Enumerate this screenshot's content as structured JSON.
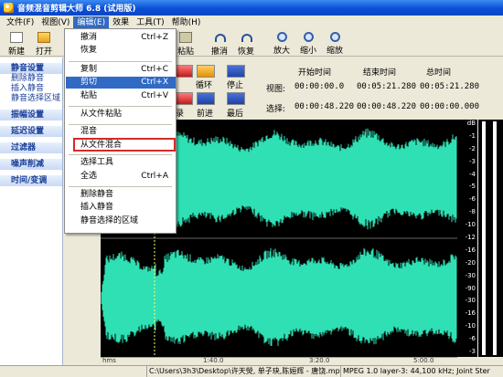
{
  "window": {
    "title": "音频混音剪辑大师 6.8 (试用版)"
  },
  "menubar": [
    {
      "label": "文件(F)"
    },
    {
      "label": "视图(V)"
    },
    {
      "label": "编辑(E)"
    },
    {
      "label": "效果"
    },
    {
      "label": "工具(T)"
    },
    {
      "label": "帮助(H)"
    }
  ],
  "toolbar": {
    "new_label": "新建",
    "open_label": "打开",
    "paste_label": "粘贴",
    "undo_label": "撤消",
    "redo_label": "恢复",
    "zoom_in_label": "放大",
    "zoom_out_label": "缩小",
    "zoom_fit_label": "缩放"
  },
  "edit_menu": {
    "items": [
      {
        "label": "撤消",
        "shortcut": "Ctrl+Z"
      },
      {
        "label": "恢复",
        "shortcut": ""
      },
      {
        "label": "复制",
        "shortcut": "Ctrl+C"
      },
      {
        "label": "剪切",
        "shortcut": "Ctrl+X"
      },
      {
        "label": "粘贴",
        "shortcut": "Ctrl+V"
      },
      {
        "label": "从文件粘贴",
        "shortcut": ""
      },
      {
        "label": "混音",
        "shortcut": ""
      },
      {
        "label": "从文件混合",
        "shortcut": ""
      },
      {
        "label": "选择工具",
        "shortcut": ""
      },
      {
        "label": "全选",
        "shortcut": "Ctrl+A"
      },
      {
        "label": "删除静音",
        "shortcut": ""
      },
      {
        "label": "插入静音",
        "shortcut": ""
      },
      {
        "label": "静音选择的区域",
        "shortcut": ""
      }
    ],
    "highlighted": "剪切",
    "outlined": "从文件混合"
  },
  "sidebar": {
    "sections": [
      {
        "label": "静音设置"
      },
      {
        "label": "删除静音"
      },
      {
        "label": "插入静音"
      },
      {
        "label": "静音选择区域"
      },
      {
        "label": "振幅设置"
      },
      {
        "label": "延迟设置"
      },
      {
        "label": "过滤器"
      },
      {
        "label": "噪声削减"
      },
      {
        "label": "时间/变调"
      }
    ]
  },
  "transport": {
    "loop_label": "循环",
    "stop_label": "停止",
    "forward_label": "前进",
    "end_label": "最后",
    "record_label": "录"
  },
  "timeinfo": {
    "start_header": "开始时间",
    "end_header": "结束时间",
    "total_header": "总时间",
    "view_label": "视图:",
    "select_label": "选择:",
    "view_start": "00:00:00.0",
    "view_end": "00:05:21.280",
    "view_total": "00:05:21.280",
    "sel_start": "00:00:48.220",
    "sel_end": "00:00:48.220",
    "sel_total": "00:00:00.000"
  },
  "db_scale": [
    "dB",
    "-1",
    "-2",
    "-3",
    "-4",
    "-5",
    "-6",
    "-8",
    "-10",
    "-12",
    "-16",
    "-20",
    "-30",
    "-90",
    "-30",
    "-16",
    "-10",
    "-6",
    "-3"
  ],
  "ruler": {
    "unit": "hms",
    "ticks": [
      "1:40.0",
      "3:20.0",
      "5:00.0"
    ]
  },
  "status": {
    "file": "C:\\Users\\3h3\\Desktop\\许天熒, 单子玦,陈姮辉 - 唐饶.mp3",
    "format": "MPEG 1.0 layer-3: 44,100 kHz; Joint Ster"
  },
  "colors": {
    "wave": "#2fe0b4",
    "background": "#000000",
    "accent": "#316ac5"
  }
}
